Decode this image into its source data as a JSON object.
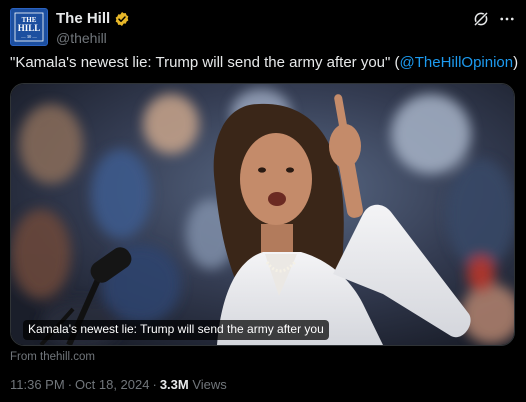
{
  "account": {
    "display_name": "The Hill",
    "handle": "@thehill",
    "avatar_lines": [
      "THE",
      "HILL",
      "— 30 —"
    ]
  },
  "tweet": {
    "text_before": "\"Kamala's newest lie: Trump will send the army after you\" (",
    "mention": "@TheHillOpinion",
    "text_after": ")"
  },
  "media": {
    "caption": "Kamala's newest lie: Trump will send the army after you"
  },
  "link_source": "From thehill.com",
  "meta": {
    "time": "11:36 PM",
    "date": "Oct 18, 2024",
    "separator": "·",
    "views_count": "3.3M",
    "views_label": "Views"
  },
  "icons": {
    "verified": "verified-badge-icon",
    "grok": "grok-icon",
    "more": "more-options-icon"
  },
  "colors": {
    "background": "#000000",
    "text_primary": "#e7e9ea",
    "text_secondary": "#71767b",
    "link": "#1d9bf0",
    "verified_gold": "#e8b829",
    "avatar_blue": "#1c4fa0"
  }
}
